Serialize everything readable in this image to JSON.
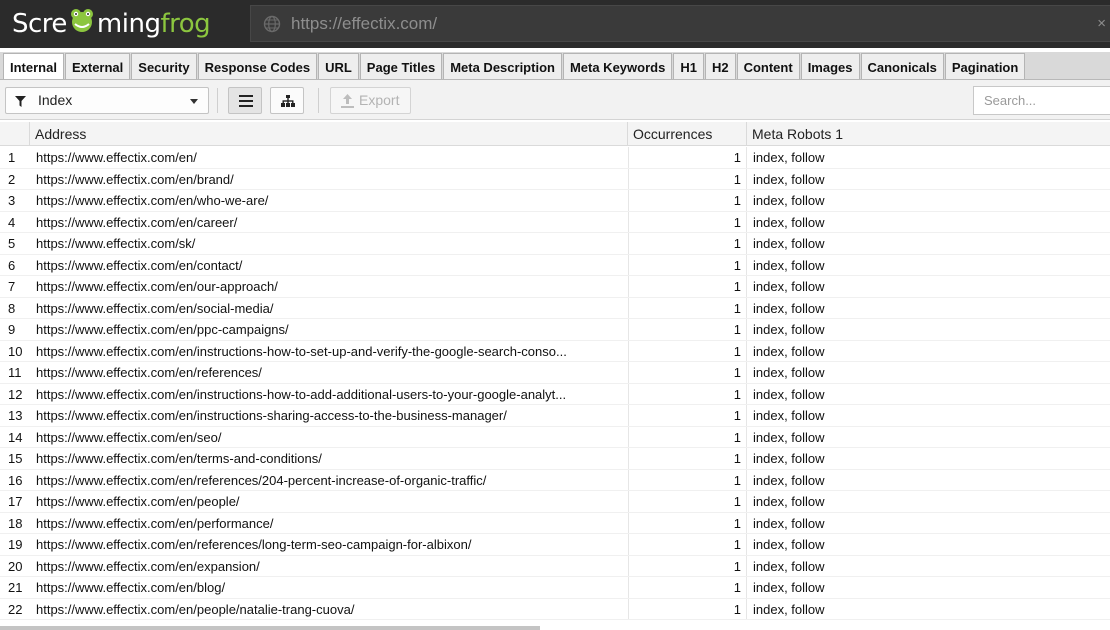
{
  "app": {
    "logo_white_1": "Scre",
    "logo_white_2": "ming",
    "logo_green": "frog",
    "url": "https://effectix.com/",
    "url_close": "×"
  },
  "tabs": [
    "Internal",
    "External",
    "Security",
    "Response Codes",
    "URL",
    "Page Titles",
    "Meta Description",
    "Meta Keywords",
    "H1",
    "H2",
    "Content",
    "Images",
    "Canonicals",
    "Pagination"
  ],
  "active_tab": "Internal",
  "toolbar": {
    "filter_value": "Index",
    "export_label": "Export",
    "search_placeholder": "Search..."
  },
  "table": {
    "columns": [
      "Address",
      "Occurrences",
      "Meta Robots 1"
    ],
    "rows": [
      {
        "n": "1",
        "address": "https://www.effectix.com/en/",
        "occ": "1",
        "robots": "index, follow"
      },
      {
        "n": "2",
        "address": "https://www.effectix.com/en/brand/",
        "occ": "1",
        "robots": "index, follow"
      },
      {
        "n": "3",
        "address": "https://www.effectix.com/en/who-we-are/",
        "occ": "1",
        "robots": "index, follow"
      },
      {
        "n": "4",
        "address": "https://www.effectix.com/en/career/",
        "occ": "1",
        "robots": "index, follow"
      },
      {
        "n": "5",
        "address": "https://www.effectix.com/sk/",
        "occ": "1",
        "robots": "index, follow"
      },
      {
        "n": "6",
        "address": "https://www.effectix.com/en/contact/",
        "occ": "1",
        "robots": "index, follow"
      },
      {
        "n": "7",
        "address": "https://www.effectix.com/en/our-approach/",
        "occ": "1",
        "robots": "index, follow"
      },
      {
        "n": "8",
        "address": "https://www.effectix.com/en/social-media/",
        "occ": "1",
        "robots": "index, follow"
      },
      {
        "n": "9",
        "address": "https://www.effectix.com/en/ppc-campaigns/",
        "occ": "1",
        "robots": "index, follow"
      },
      {
        "n": "10",
        "address": "https://www.effectix.com/en/instructions-how-to-set-up-and-verify-the-google-search-conso...",
        "occ": "1",
        "robots": "index, follow"
      },
      {
        "n": "11",
        "address": "https://www.effectix.com/en/references/",
        "occ": "1",
        "robots": "index, follow"
      },
      {
        "n": "12",
        "address": "https://www.effectix.com/en/instructions-how-to-add-additional-users-to-your-google-analyt...",
        "occ": "1",
        "robots": "index, follow"
      },
      {
        "n": "13",
        "address": "https://www.effectix.com/en/instructions-sharing-access-to-the-business-manager/",
        "occ": "1",
        "robots": "index, follow"
      },
      {
        "n": "14",
        "address": "https://www.effectix.com/en/seo/",
        "occ": "1",
        "robots": "index, follow"
      },
      {
        "n": "15",
        "address": "https://www.effectix.com/en/terms-and-conditions/",
        "occ": "1",
        "robots": "index, follow"
      },
      {
        "n": "16",
        "address": "https://www.effectix.com/en/references/204-percent-increase-of-organic-traffic/",
        "occ": "1",
        "robots": "index, follow"
      },
      {
        "n": "17",
        "address": "https://www.effectix.com/en/people/",
        "occ": "1",
        "robots": "index, follow"
      },
      {
        "n": "18",
        "address": "https://www.effectix.com/en/performance/",
        "occ": "1",
        "robots": "index, follow"
      },
      {
        "n": "19",
        "address": "https://www.effectix.com/en/references/long-term-seo-campaign-for-albixon/",
        "occ": "1",
        "robots": "index, follow"
      },
      {
        "n": "20",
        "address": "https://www.effectix.com/en/expansion/",
        "occ": "1",
        "robots": "index, follow"
      },
      {
        "n": "21",
        "address": "https://www.effectix.com/en/blog/",
        "occ": "1",
        "robots": "index, follow"
      },
      {
        "n": "22",
        "address": "https://www.effectix.com/en/people/natalie-trang-cuova/",
        "occ": "1",
        "robots": "index, follow"
      }
    ]
  },
  "colors": {
    "topbar": "#2b2b2b",
    "brand_green": "#8cc63f",
    "tab_strip": "#d9d9d9"
  }
}
